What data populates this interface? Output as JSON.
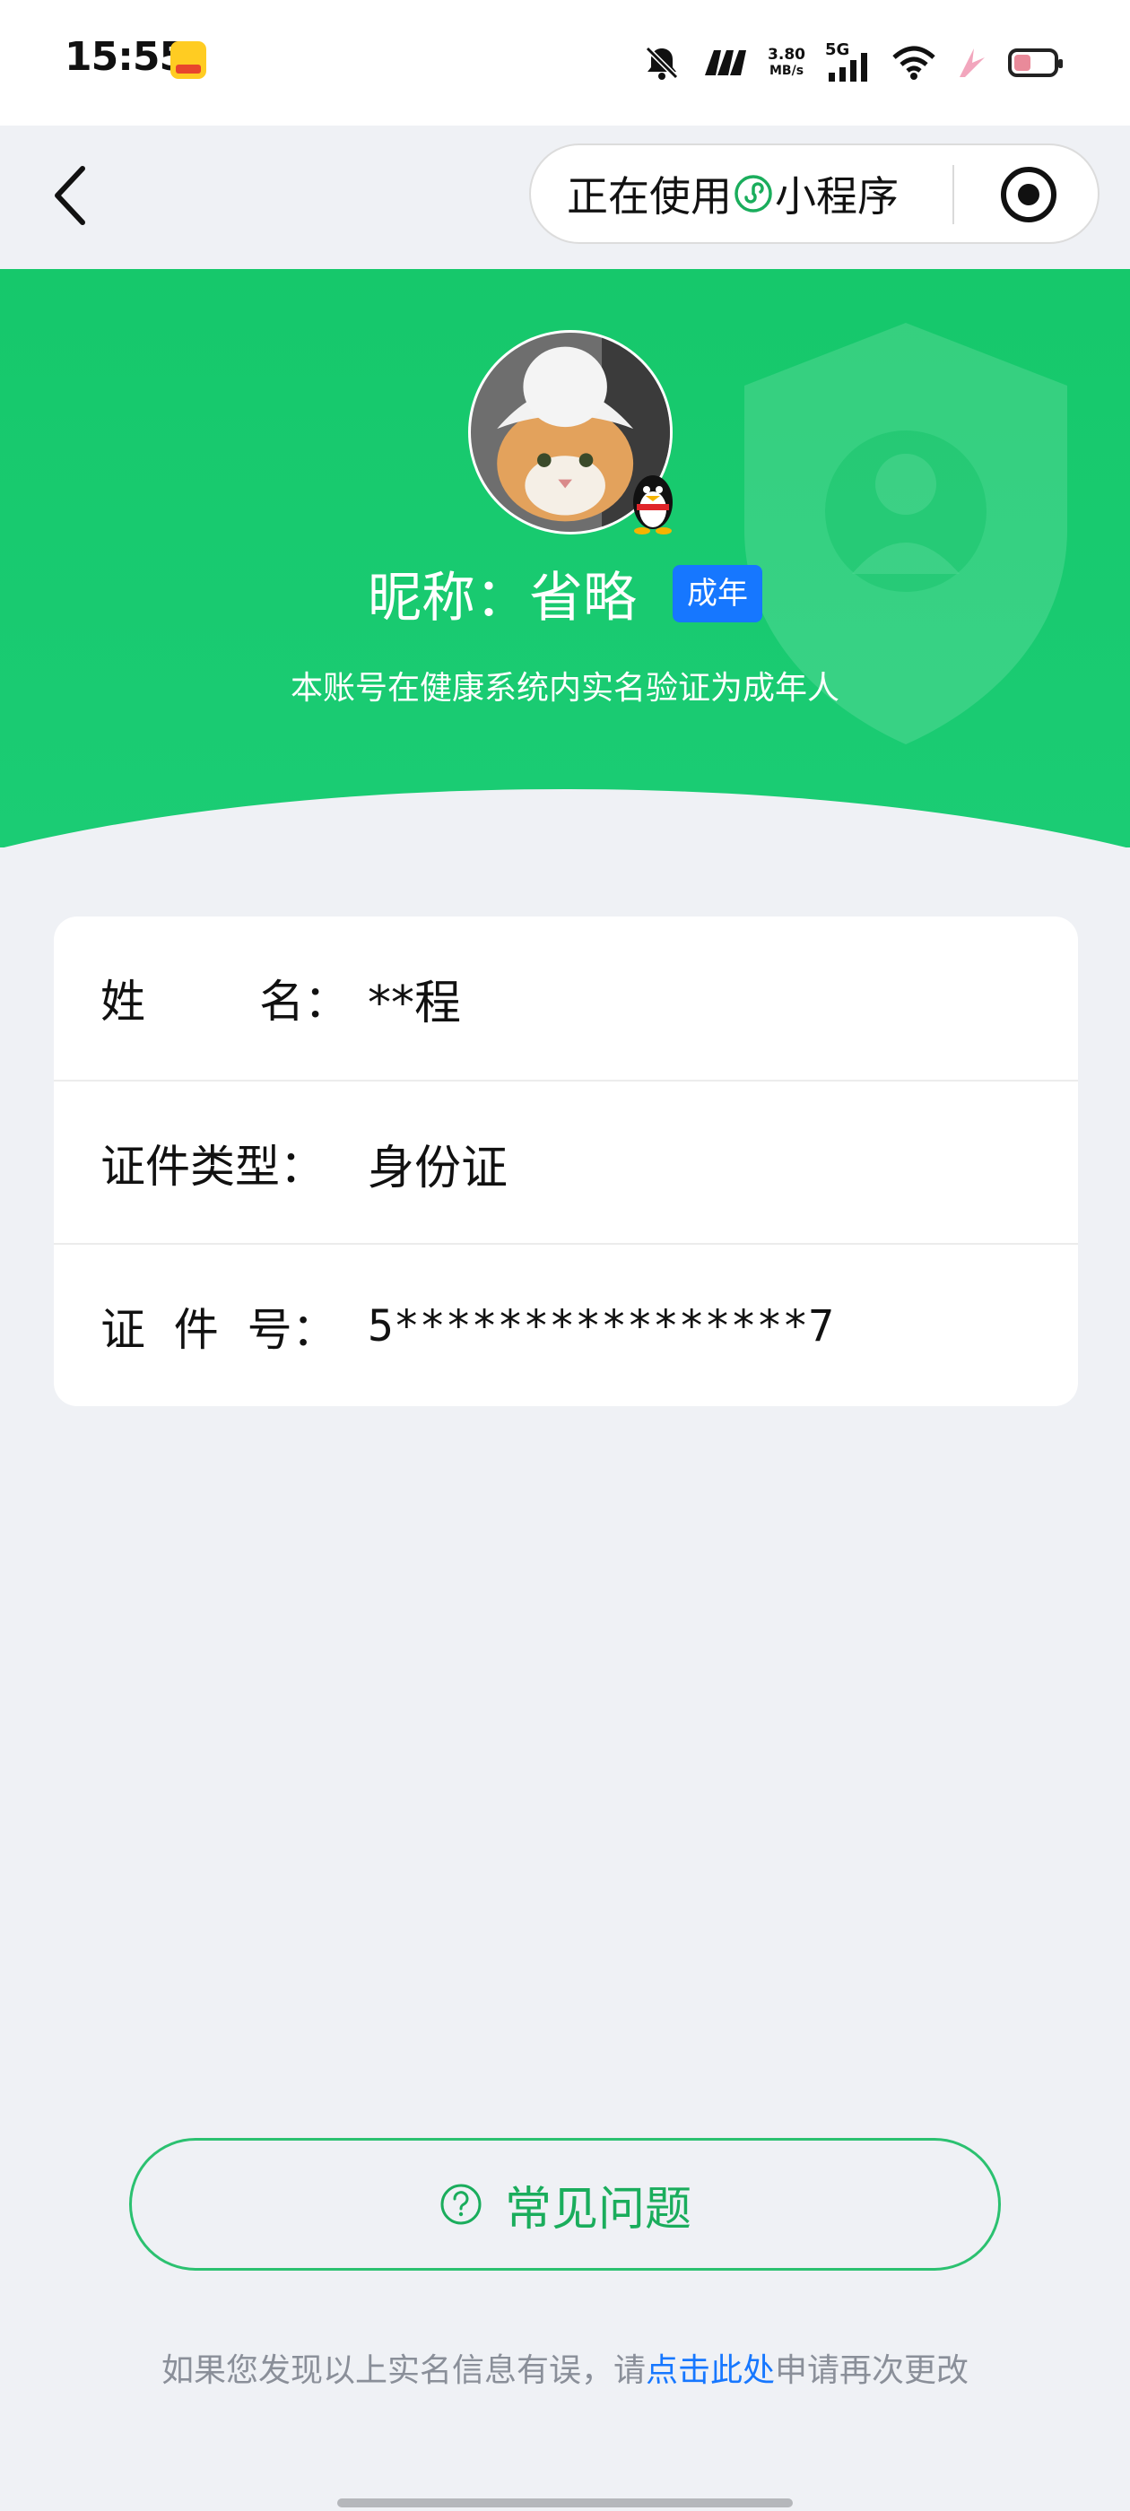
{
  "status_bar": {
    "time": "15:55",
    "network_speed_value": "3.80",
    "network_speed_unit": "MB/s",
    "signal": "5G",
    "icons": [
      "app-badge-icon",
      "mute-bell-icon",
      "m-app-icon",
      "signal-bars-icon",
      "wifi-icon",
      "charging-icon",
      "battery-icon"
    ]
  },
  "nav": {
    "back_icon": "chevron-left-icon",
    "capsule_prefix": "正在使用",
    "capsule_suffix": "小程序",
    "record_icon": "record-icon"
  },
  "profile": {
    "nickname": "昵称：省略",
    "age_tag": "成年",
    "verify_note": "本账号在健康系统内实名验证为成年人",
    "avatar_icon": "cat-avatar",
    "badge_icon": "qq-penguin-icon"
  },
  "info": {
    "rows": [
      {
        "label": "姓        名：",
        "value": "**程"
      },
      {
        "label": "证件类型：",
        "value": "身份证"
      },
      {
        "label": "证  件  号：",
        "value": "5****************7"
      }
    ]
  },
  "faq": {
    "label": "常见问题",
    "icon": "question-circle-icon"
  },
  "footer": {
    "prefix": "如果您发现以上实名信息有误，请",
    "link": "点击此处",
    "suffix": "申请再次更改"
  },
  "colors": {
    "primary_green": "#1bcc74",
    "link_blue": "#1677ff",
    "background": "#eff1f5"
  }
}
